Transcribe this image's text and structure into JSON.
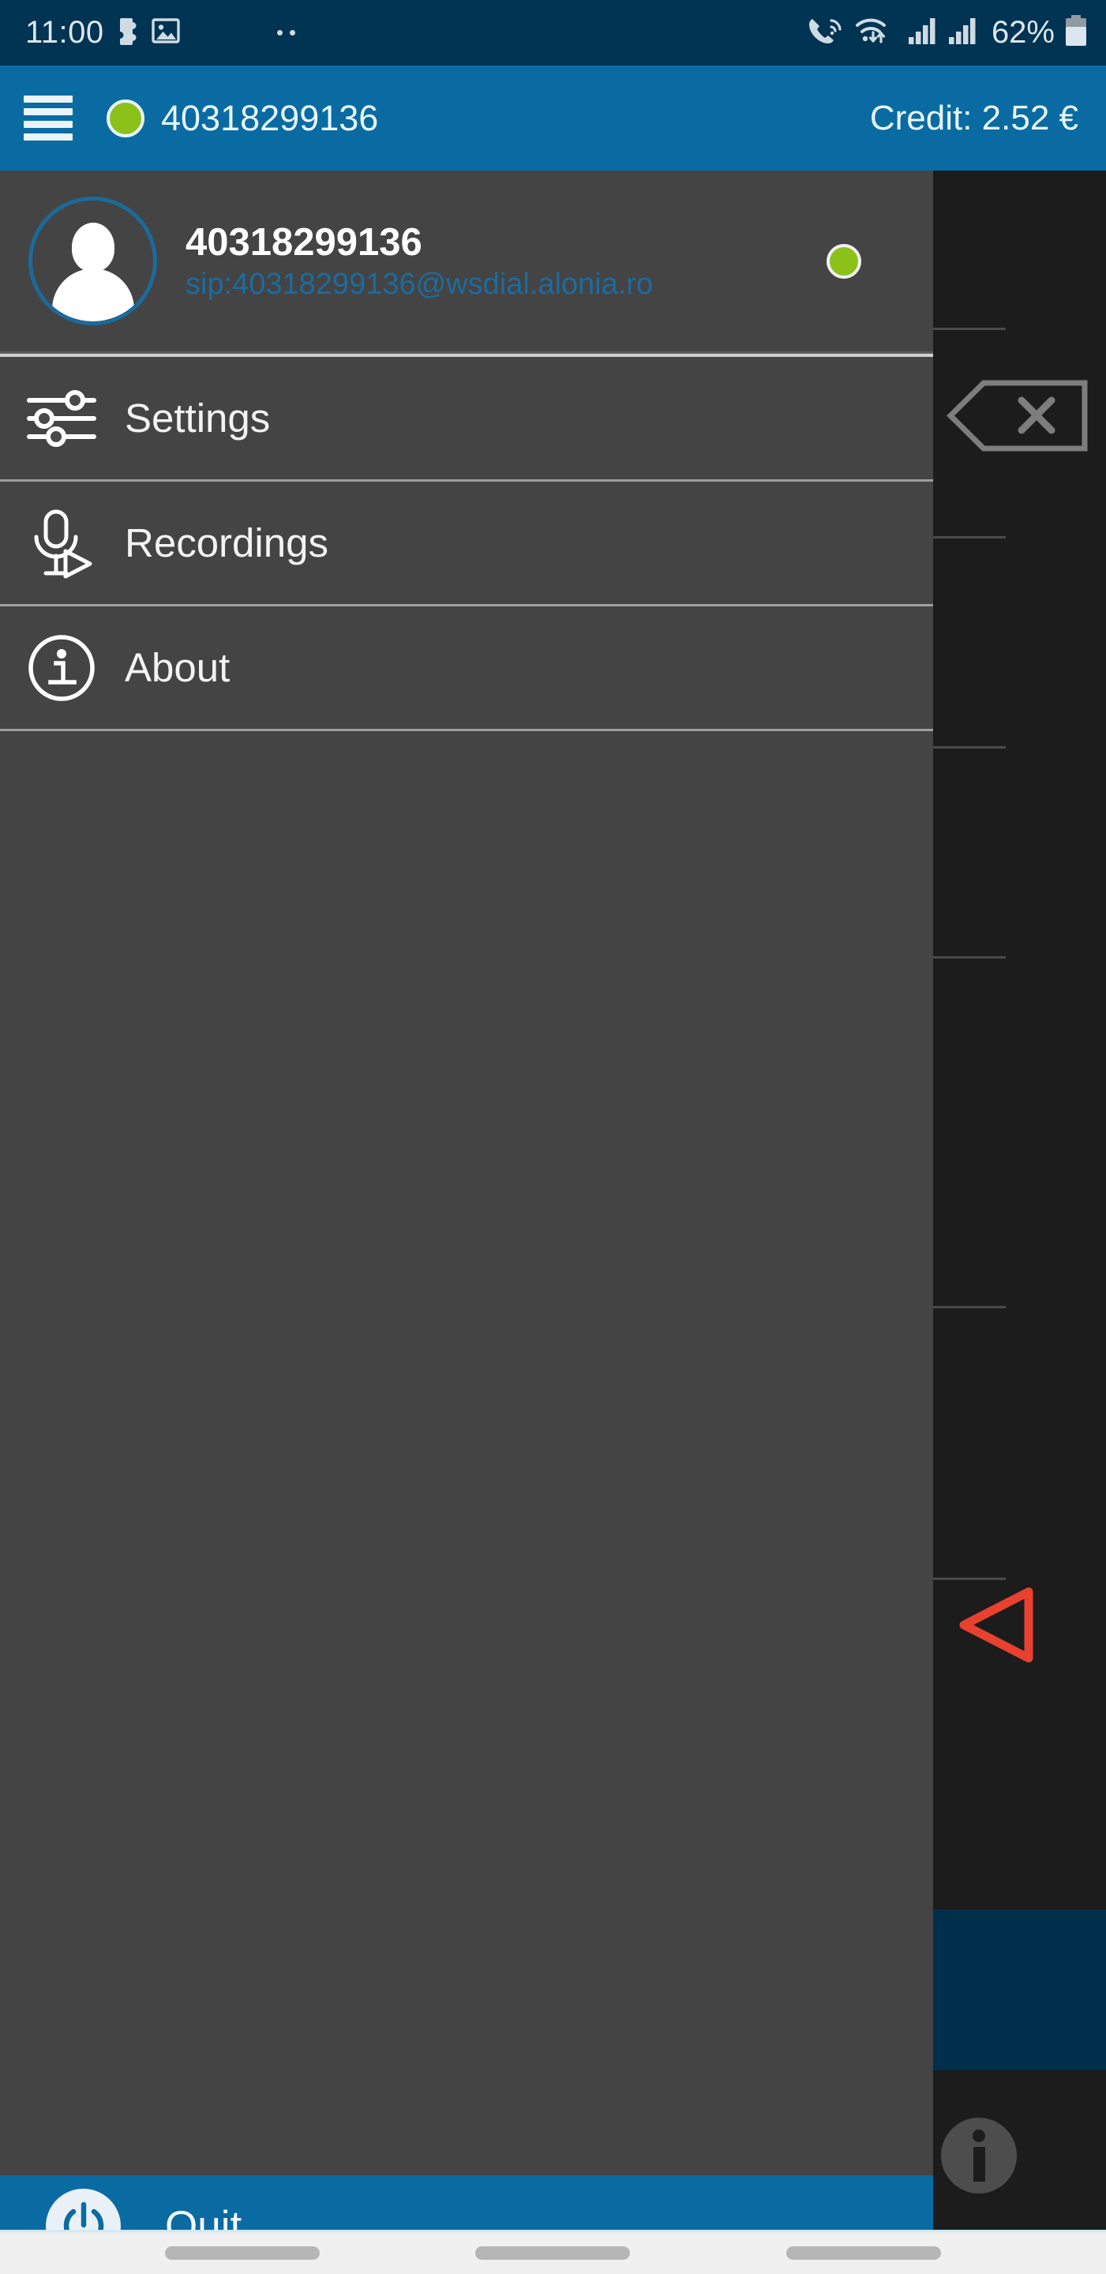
{
  "status_bar": {
    "clock": "11:00",
    "battery_percent": "62%",
    "icons": [
      "puzzle-icon",
      "image-icon",
      "wifi-calling-icon",
      "wifi-icon",
      "signal-bars-icon",
      "signal-bars-icon",
      "battery-icon"
    ],
    "background_color": "#013352",
    "text_color": "#dbe7ee"
  },
  "app_header": {
    "menu_icon": "hamburger-menu-icon",
    "status_dot": "online-status-dot",
    "status_color": "#8cc11a",
    "account": "40318299136",
    "credit_label": "Credit: 2.52 €",
    "background_color": "#0a6ba3"
  },
  "drawer": {
    "background_color": "#444444",
    "profile": {
      "avatar_icon": "user-avatar-icon",
      "name": "40318299136",
      "sip_uri": "sip:40318299136@wsdial.alonia.ro",
      "sip_color": "#1d6b9e",
      "status_dot": "online-status-dot",
      "status_color": "#8cc11a"
    },
    "items": [
      {
        "label": "Settings",
        "icon": "sliders-icon"
      },
      {
        "label": "Recordings",
        "icon": "microphone-play-icon"
      },
      {
        "label": "About",
        "icon": "info-circle-icon"
      }
    ],
    "quit": {
      "label": "Quit",
      "icon": "power-icon",
      "background_color": "#0a6ba3"
    }
  },
  "dialer_background": {
    "background_color": "#1c1c1c",
    "backspace_icon": "backspace-delete-icon",
    "call_icon": "call-triangle-icon",
    "call_icon_color": "#e8412f",
    "info_button_icon": "info-icon",
    "navy_panel_color": "#002f4c"
  },
  "nav_bar": {
    "background_color": "#f0f0f0",
    "buttons": [
      "recents-button",
      "home-button",
      "back-button"
    ]
  }
}
